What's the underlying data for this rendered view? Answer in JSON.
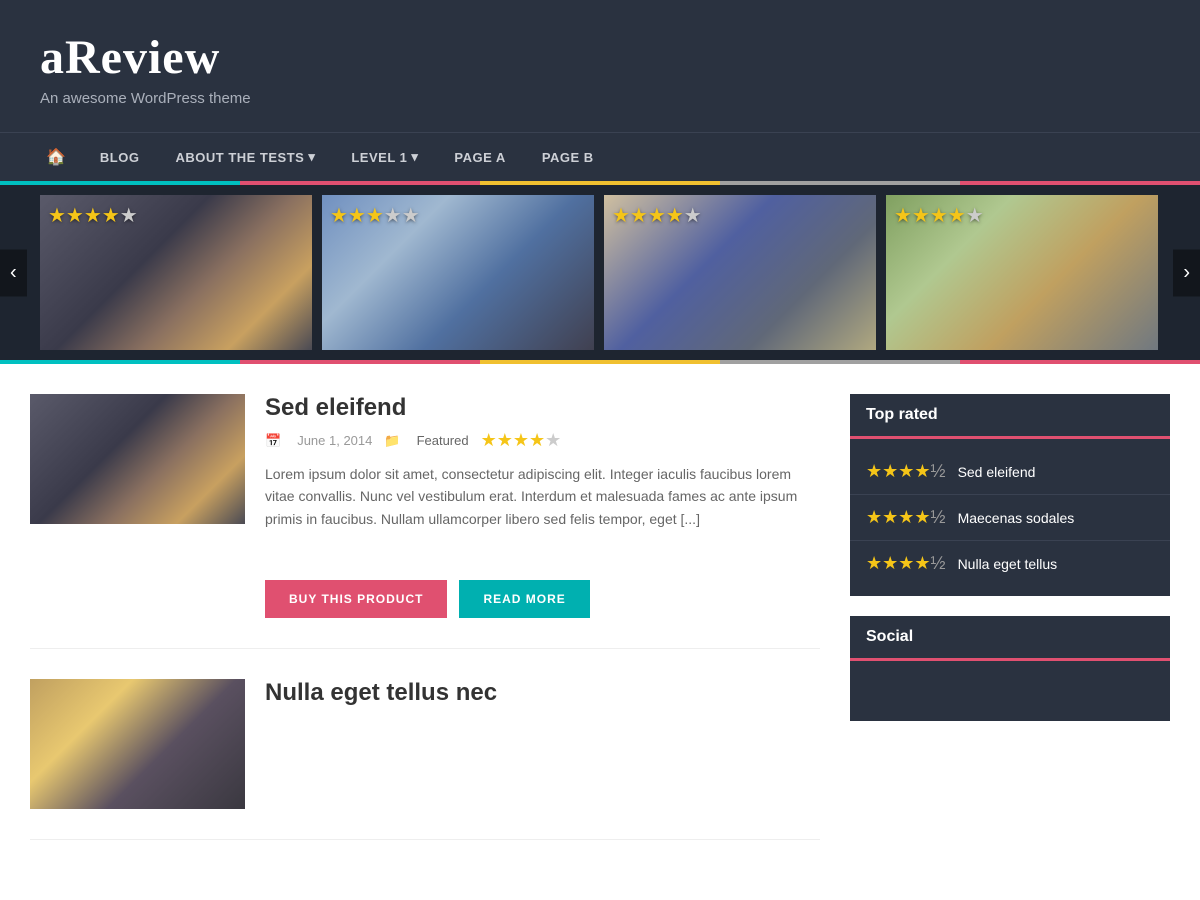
{
  "site": {
    "title": "aReview",
    "tagline": "An awesome WordPress theme"
  },
  "nav": {
    "home_icon": "🏠",
    "items": [
      {
        "label": "BLOG",
        "has_arrow": false
      },
      {
        "label": "ABOUT THE TESTS",
        "has_arrow": true
      },
      {
        "label": "LEVEL 1",
        "has_arrow": true
      },
      {
        "label": "PAGE A",
        "has_arrow": false
      },
      {
        "label": "PAGE B",
        "has_arrow": false
      }
    ]
  },
  "carousel": {
    "items": [
      {
        "stars": 4.5,
        "stars_display": "★★★★½"
      },
      {
        "stars": 3.5,
        "stars_display": "★★★½☆"
      },
      {
        "stars": 4.0,
        "stars_display": "★★★★☆"
      },
      {
        "stars": 4.0,
        "stars_display": "★★★★☆"
      }
    ],
    "prev_label": "‹",
    "next_label": "›"
  },
  "posts": [
    {
      "title": "Sed eleifend",
      "date": "June 1, 2014",
      "category": "Featured",
      "stars_display": "★★★★½",
      "excerpt": "Lorem ipsum dolor sit amet, consectetur adipiscing elit. Integer iaculis faucibus lorem vitae convallis. Nunc vel vestibulum erat. Interdum et malesuada fames ac ante ipsum primis in faucibus. Nullam ullamcorper libero sed felis tempor, eget [...]",
      "buy_label": "BUY THIS PRODUCT",
      "read_label": "READ MORE"
    },
    {
      "title": "Nulla eget tellus nec",
      "date": "",
      "category": "",
      "stars_display": "",
      "excerpt": "",
      "buy_label": "",
      "read_label": ""
    }
  ],
  "sidebar": {
    "top_rated": {
      "title": "Top rated",
      "items": [
        {
          "name": "Sed eleifend",
          "stars": "★★★★½"
        },
        {
          "name": "Maecenas sodales",
          "stars": "★★★★½"
        },
        {
          "name": "Nulla eget tellus",
          "stars": "★★★★½"
        }
      ]
    },
    "social": {
      "title": "Social"
    }
  }
}
